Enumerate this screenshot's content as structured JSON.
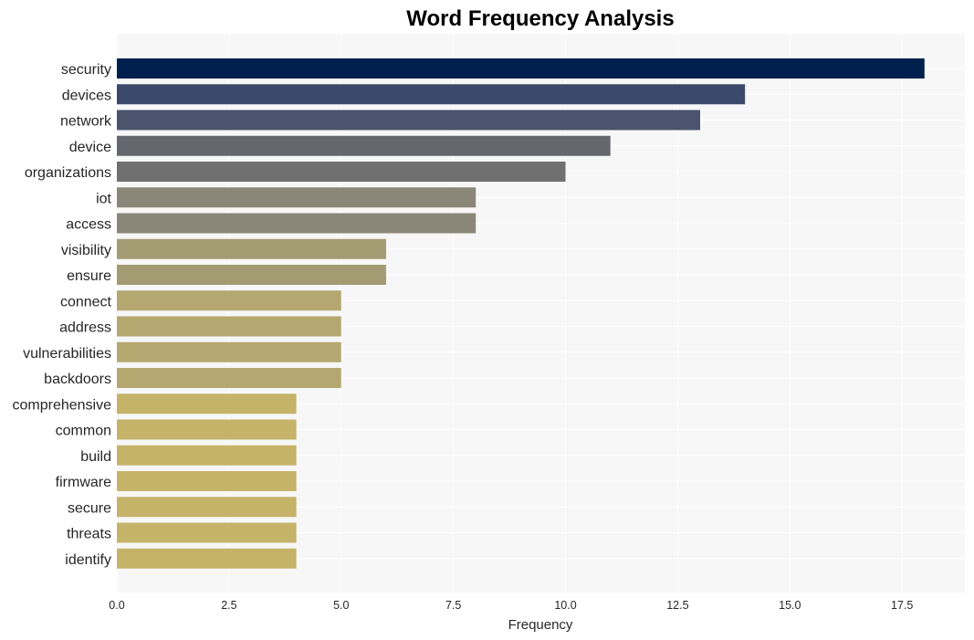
{
  "chart_data": {
    "type": "bar",
    "orientation": "horizontal",
    "title": "Word Frequency Analysis",
    "xlabel": "Frequency",
    "ylabel": "",
    "xlim": [
      0,
      18.9
    ],
    "xticks": [
      "0.0",
      "2.5",
      "5.0",
      "7.5",
      "10.0",
      "12.5",
      "15.0",
      "17.5"
    ],
    "grid": true,
    "categories": [
      "security",
      "devices",
      "network",
      "device",
      "organizations",
      "iot",
      "access",
      "visibility",
      "ensure",
      "connect",
      "address",
      "vulnerabilities",
      "backdoors",
      "comprehensive",
      "common",
      "build",
      "firmware",
      "secure",
      "threats",
      "identify"
    ],
    "values": [
      18,
      14,
      13,
      11,
      10,
      8,
      8,
      6,
      6,
      5,
      5,
      5,
      5,
      4,
      4,
      4,
      4,
      4,
      4,
      4
    ],
    "colors": [
      "#00214e",
      "#3b4a6b",
      "#4a546c",
      "#65676f",
      "#707070",
      "#8b8778",
      "#8b8778",
      "#a39b72",
      "#a39b72",
      "#b4a770",
      "#b4a770",
      "#b4a770",
      "#b4a770",
      "#c5b36a",
      "#c5b36a",
      "#c5b36a",
      "#c5b36a",
      "#c5b36a",
      "#c5b36a",
      "#c5b36a"
    ],
    "background": "#f7f7f7"
  }
}
